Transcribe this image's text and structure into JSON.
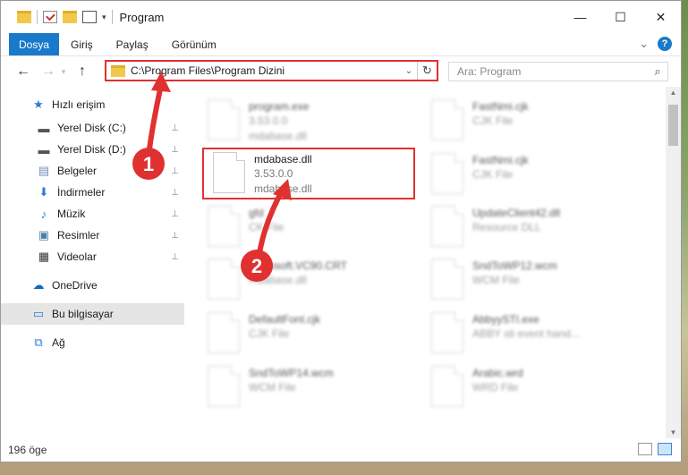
{
  "window": {
    "title": "Program",
    "controls": {
      "minimize": "—",
      "maximize": "☐",
      "close": "✕"
    }
  },
  "ribbon": {
    "tabs": [
      "Dosya",
      "Giriş",
      "Paylaş",
      "Görünüm"
    ],
    "expand_glyph": "⌄",
    "help_glyph": "?"
  },
  "nav": {
    "back": "←",
    "forward": "→",
    "up": "↑",
    "address": "C:\\Program Files\\Program Dizini",
    "address_dropdown": "⌄",
    "refresh": "↻",
    "search_placeholder": "Ara: Program",
    "search_icon": "⌕"
  },
  "sidebar": {
    "items": [
      {
        "label": "Hızlı erişim",
        "icon": "star-icon",
        "glyph": "★",
        "color": "#2b7cd3",
        "pinned": false
      },
      {
        "label": "Yerel Disk (C:)",
        "icon": "drive-icon",
        "glyph": "▬",
        "color": "#555555",
        "pinned": true
      },
      {
        "label": "Yerel Disk (D:)",
        "icon": "drive-icon",
        "glyph": "▬",
        "color": "#555555",
        "pinned": true
      },
      {
        "label": "Belgeler",
        "icon": "documents-icon",
        "glyph": "▤",
        "color": "#6f8fb5",
        "pinned": true
      },
      {
        "label": "İndirmeler",
        "icon": "download-icon",
        "glyph": "⬇",
        "color": "#2b7cd3",
        "pinned": true
      },
      {
        "label": "Müzik",
        "icon": "music-icon",
        "glyph": "♪",
        "color": "#2b7cd3",
        "pinned": true
      },
      {
        "label": "Resimler",
        "icon": "pictures-icon",
        "glyph": "▣",
        "color": "#4a7fb0",
        "pinned": true
      },
      {
        "label": "Videolar",
        "icon": "videos-icon",
        "glyph": "▦",
        "color": "#333333",
        "pinned": true
      },
      {
        "label": "OneDrive",
        "icon": "cloud-icon",
        "glyph": "☁",
        "color": "#0f6cbd",
        "pinned": false
      },
      {
        "label": "Bu bilgisayar",
        "icon": "computer-icon",
        "glyph": "▭",
        "color": "#2b7cd3",
        "pinned": false,
        "selected": true
      },
      {
        "label": "Ağ",
        "icon": "network-icon",
        "glyph": "⧉",
        "color": "#2b7cd3",
        "pinned": false
      }
    ],
    "pin_glyph": "📌"
  },
  "files": {
    "featured": {
      "name": "mdabase.dll",
      "version": "3.53.0.0",
      "description": "mdabase.dll"
    },
    "background": [
      {
        "name": "program.exe",
        "line1": "3.53.0.0",
        "line2": "mdabase.dll"
      },
      {
        "name": "FastNmi.cjk",
        "line1": "CJK File",
        "line2": ""
      },
      {
        "name": "FastNmi.cjk",
        "line1": "CJK File",
        "line2": ""
      },
      {
        "name": "gfd",
        "line1": "CK File",
        "line2": ""
      },
      {
        "name": "UpdateClient42.dll",
        "line1": "Resource DLL",
        "line2": ""
      },
      {
        "name": "Microsoft.VC90.CRT",
        "line1": "",
        "line2": "mdabase.dll"
      },
      {
        "name": "SndToWP12.wcm",
        "line1": "WCM File",
        "line2": ""
      },
      {
        "name": "DefaultFont.cjk",
        "line1": "CJK File",
        "line2": ""
      },
      {
        "name": "AbbyySTI.exe",
        "line1": "ABBY sti event hand...",
        "line2": ""
      },
      {
        "name": "SndToWP14.wcm",
        "line1": "WCM File",
        "line2": ""
      },
      {
        "name": "Arabic.wrd",
        "line1": "WRD File",
        "line2": ""
      }
    ]
  },
  "annotations": {
    "step1": "1",
    "step2": "2",
    "color": "#e03131"
  },
  "status": {
    "count": "196 öge"
  }
}
